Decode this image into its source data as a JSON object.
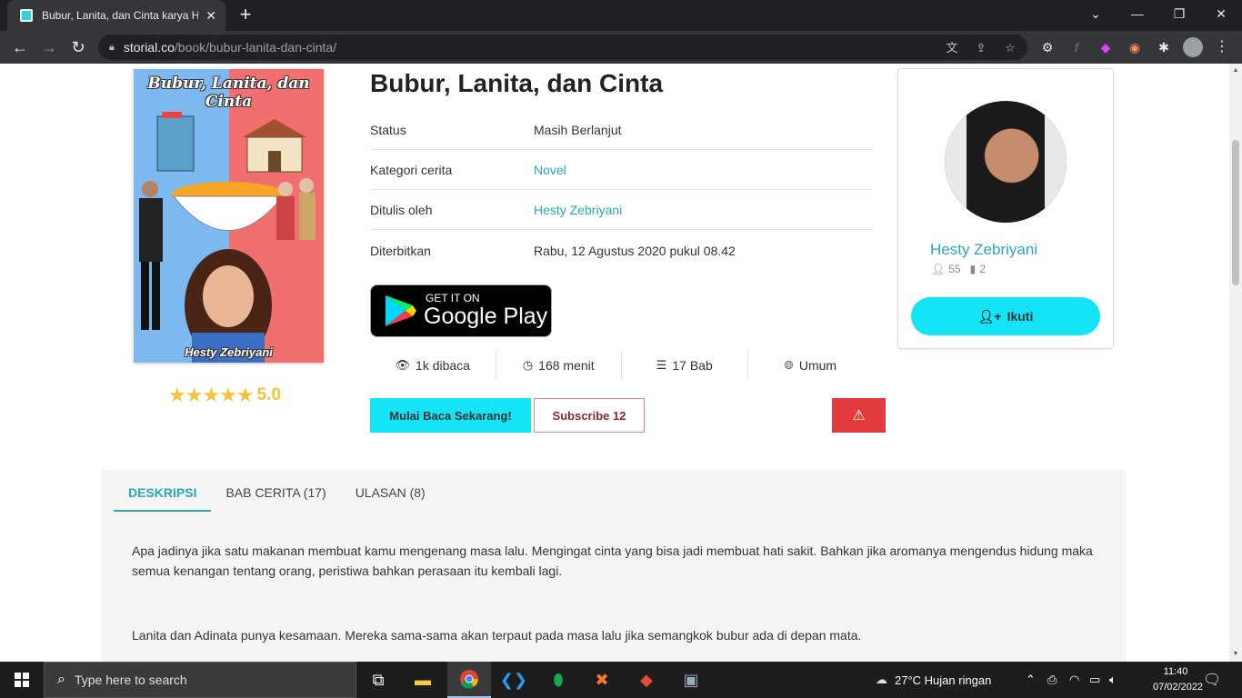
{
  "browser": {
    "tab_title": "Bubur, Lanita, dan Cinta karya He",
    "url_host": "storial.co",
    "url_path": "/book/bubur-lanita-dan-cinta/"
  },
  "book": {
    "title": "Bubur, Lanita, dan Cinta",
    "cover_title": "Bubur, Lanita, dan Cinta",
    "cover_author": "Hesty Zebriyani",
    "rating": "5.0",
    "info": [
      {
        "label": "Status",
        "value": "Masih Berlanjut"
      },
      {
        "label": "Kategori cerita",
        "value": "Novel"
      },
      {
        "label": "Ditulis oleh",
        "value": "Hesty Zebriyani"
      },
      {
        "label": "Diterbitkan",
        "value": "Rabu, 12 Agustus 2020 pukul 08.42"
      }
    ],
    "google_play": {
      "small": "GET IT ON",
      "big": "Google Play"
    },
    "stats": [
      {
        "icon": "eye-icon",
        "text": "1k dibaca"
      },
      {
        "icon": "clock-icon",
        "text": "168 menit"
      },
      {
        "icon": "list-icon",
        "text": "17 Bab"
      },
      {
        "icon": "globe-icon",
        "text": "Umum"
      }
    ],
    "read_button": "Mulai Baca Sekarang!",
    "subscribe_button": "Subscribe 12"
  },
  "author": {
    "name": "Hesty Zebriyani",
    "followers": "55",
    "books": "2",
    "follow_button": "Ikuti"
  },
  "tabs": [
    "DESKRIPSI",
    "BAB CERITA (17)",
    "ULASAN (8)"
  ],
  "description": [
    "Apa jadinya jika satu makanan membuat kamu mengenang masa lalu. Mengingat cinta yang bisa jadi membuat hati sakit. Bahkan jika aromanya mengendus hidung maka semua kenangan tentang orang, peristiwa bahkan perasaan itu kembali lagi.",
    "Lanita dan Adinata punya kesamaan. Mereka sama-sama akan terpaut pada masa lalu jika semangkok bubur ada di depan mata."
  ],
  "taskbar": {
    "search_placeholder": "Type here to search",
    "weather": "27°C  Hujan ringan",
    "time": "11:40",
    "date": "07/02/2022"
  },
  "colors": {
    "accent": "#14e4f6",
    "link": "#2aa8b5",
    "star": "#f6c23e",
    "danger": "#e23b3b"
  }
}
